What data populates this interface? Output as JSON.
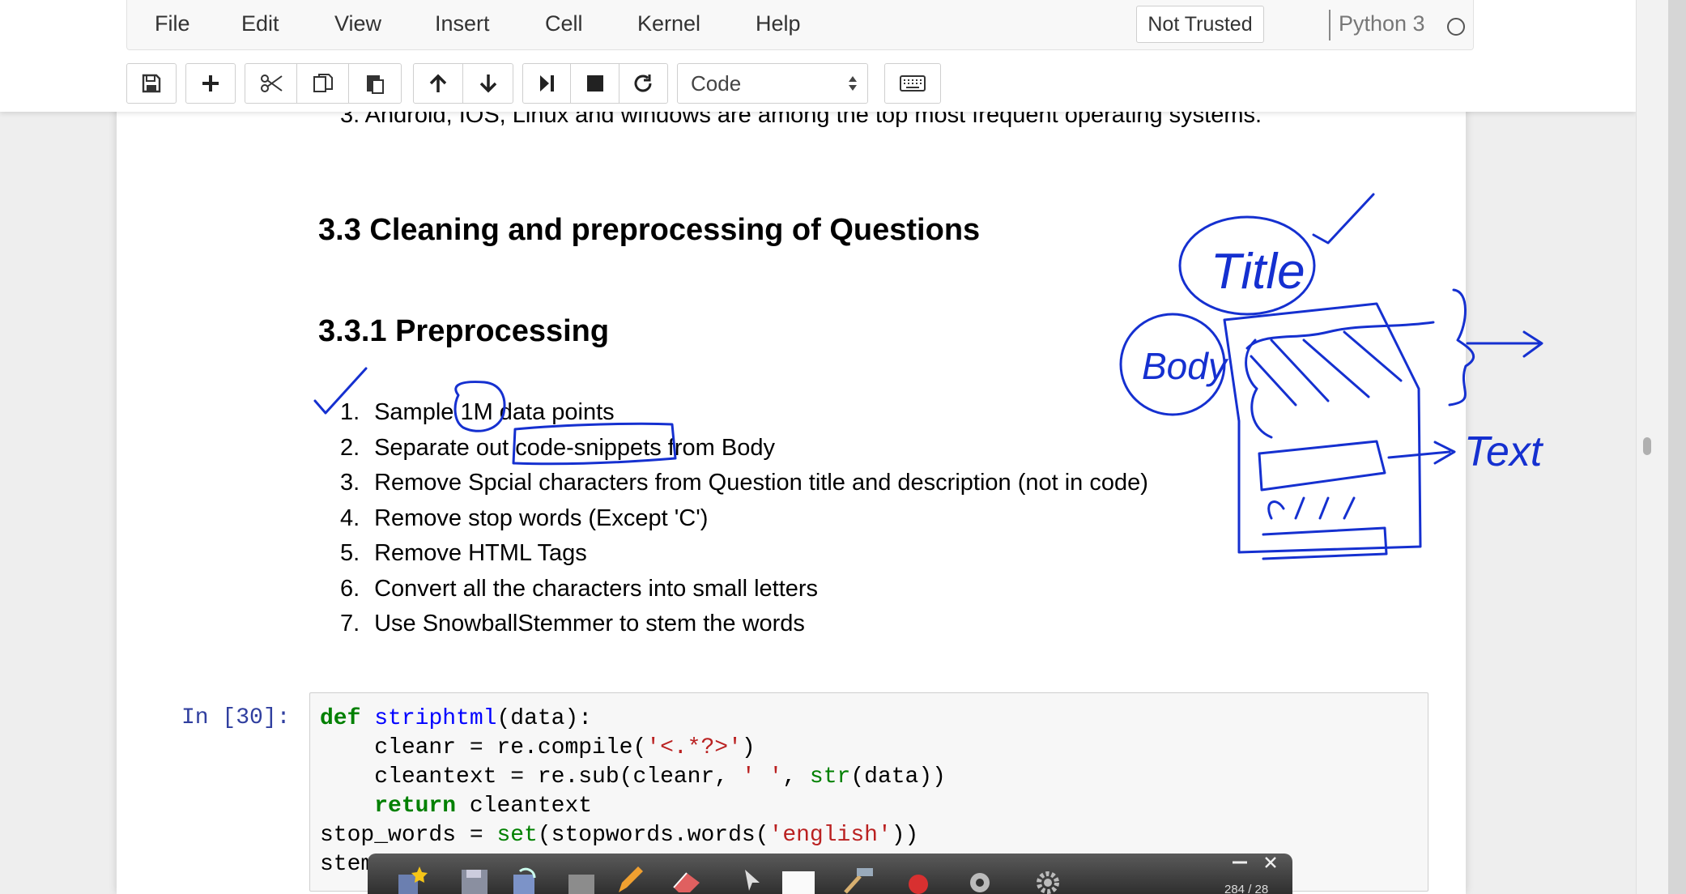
{
  "menubar": {
    "items": [
      "File",
      "Edit",
      "View",
      "Insert",
      "Cell",
      "Kernel",
      "Help"
    ],
    "trust_status": "Not Trusted",
    "kernel_name": "Python 3"
  },
  "toolbar": {
    "cell_type": "Code",
    "icons": [
      "save-icon",
      "plus-icon",
      "scissors-icon",
      "copy-icon",
      "paste-icon",
      "arrow-up-icon",
      "arrow-down-icon",
      "run-icon",
      "stop-icon",
      "restart-icon",
      "keyboard-icon"
    ]
  },
  "notebook": {
    "previous_line": "3.  Android, IOS, Linux and windows are among the top most frequent operating systems.",
    "heading_section": "3.3 Cleaning and preprocessing of Questions",
    "heading_subsection": "3.3.1 Preprocessing",
    "steps": [
      {
        "num": "1.",
        "text": "Sample 1M data points"
      },
      {
        "num": "2.",
        "text": "Separate out code-snippets from Body"
      },
      {
        "num": "3.",
        "text": "Remove Spcial characters from Question title and description (not in code)"
      },
      {
        "num": "4.",
        "text": "Remove stop words (Except 'C')"
      },
      {
        "num": "5.",
        "text": "Remove HTML Tags"
      },
      {
        "num": "6.",
        "text": "Convert all the characters into small letters"
      },
      {
        "num": "7.",
        "text": "Use SnowballStemmer to stem the words"
      }
    ],
    "code_cell": {
      "prompt": "In [30]:",
      "lines": [
        "def striphtml(data):",
        "    cleanr = re.compile('<.*?>')",
        "    cleantext = re.sub(cleanr, ' ', str(data))",
        "    return cleantext",
        "stop_words = set(stopwords.words('english'))",
        "stemmer = SnowballStemmer(\"english\")"
      ]
    }
  },
  "annotations": {
    "title_label": "Title",
    "body_label": "Body",
    "text_label": "Text"
  },
  "recorder": {
    "page_counter": "284 / 28"
  },
  "colors": {
    "ink": "#1530d0",
    "prompt": "#303f9f",
    "keyword": "#008000",
    "function": "#0000ff",
    "string": "#ba2121"
  }
}
